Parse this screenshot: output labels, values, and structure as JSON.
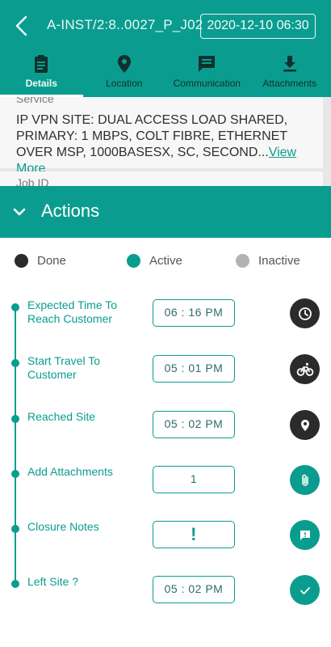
{
  "header": {
    "job_id": "A-INST/2:8..0027_P_J02",
    "datetime": "2020-12-10 06:30",
    "tabs": [
      {
        "label": "Details",
        "icon": "clipboard-icon",
        "active": true
      },
      {
        "label": "Location",
        "icon": "map-pin-icon",
        "active": false
      },
      {
        "label": "Communication",
        "icon": "chat-icon",
        "active": false
      },
      {
        "label": "Attachments",
        "icon": "download-icon",
        "active": false
      }
    ]
  },
  "details": {
    "service_label": "Service",
    "service_text": "IP VPN SITE: DUAL ACCESS LOAD SHARED, PRIMARY: 1 MBPS, COLT FIBRE, ETHERNET OVER MSP, 1000BASESX, SC, SECOND...",
    "view_more": "View More",
    "job_id_label": "Job ID"
  },
  "actions": {
    "title": "Actions",
    "legend": [
      {
        "label": "Done",
        "color": "#2b2b2b"
      },
      {
        "label": "Active",
        "color": "#0a9d8f"
      },
      {
        "label": "Inactive",
        "color": "#b3b3b3"
      }
    ],
    "steps": [
      {
        "label": "Expected Time To Reach Customer",
        "value": "06 : 16 PM",
        "icon": "clock-icon",
        "state": "done"
      },
      {
        "label": "Start Travel To Customer",
        "value": "05 : 01 PM",
        "icon": "bicycle-icon",
        "state": "done"
      },
      {
        "label": "Reached Site",
        "value": "05 : 02 PM",
        "icon": "location-pin-icon",
        "state": "done"
      },
      {
        "label": "Add Attachments",
        "value": "1",
        "icon": "paperclip-icon",
        "state": "active"
      },
      {
        "label": "Closure Notes",
        "value": "!",
        "icon": "note-icon",
        "state": "active"
      },
      {
        "label": "Left Site ?",
        "value": "05 : 02 PM",
        "icon": "check-icon",
        "state": "active"
      }
    ]
  },
  "colors": {
    "primary": "#0a9d8f",
    "done": "#2b2b2b",
    "inactive": "#b3b3b3"
  }
}
